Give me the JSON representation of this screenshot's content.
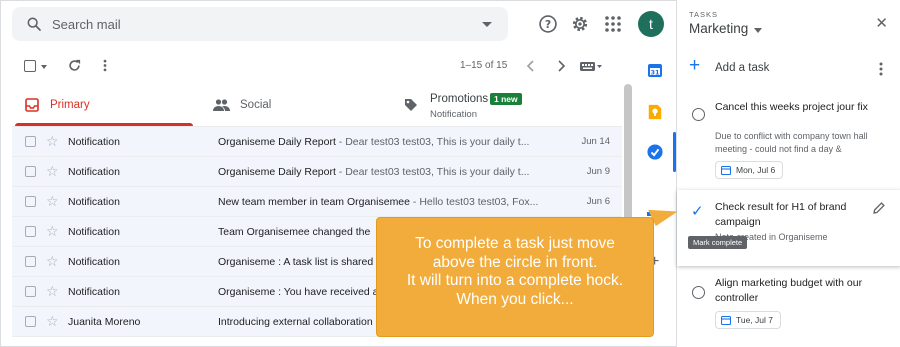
{
  "search": {
    "placeholder": "Search mail",
    "icon": "search-icon"
  },
  "topbar": {
    "help_icon": "help-icon",
    "settings_icon": "gear-icon",
    "apps_icon": "apps-grid-icon",
    "avatar_letter": "t",
    "avatar_color": "#1e6f5c"
  },
  "toolbar": {
    "pager": "1–15 of 15"
  },
  "tabs": [
    {
      "label": "Primary",
      "icon": "inbox-icon",
      "active": true
    },
    {
      "label": "Social",
      "icon": "people-icon"
    },
    {
      "label": "Promotions",
      "icon": "tag-icon",
      "sublabel": "Notification",
      "badge": "1 new"
    }
  ],
  "emails": [
    {
      "sender": "Notification",
      "subject": "Organiseme Daily Report",
      "snippet": " - Dear test03 test03, This is your daily t...",
      "date": "Jun 14"
    },
    {
      "sender": "Notification",
      "subject": "Organiseme Daily Report",
      "snippet": " - Dear test03 test03, This is your daily t...",
      "date": "Jun 9"
    },
    {
      "sender": "Notification",
      "subject": "New team member in team Organisemee",
      "snippet": " - Hello test03 test03, Fox...",
      "date": "Jun 6"
    },
    {
      "sender": "Notification",
      "subject": "Team Organisemee changed the",
      "snippet": "",
      "date": ""
    },
    {
      "sender": "Notification",
      "subject": "Organiseme : A task list is shared",
      "snippet": "",
      "date": ""
    },
    {
      "sender": "Notification",
      "subject": "Organiseme : You have received a",
      "snippet": "",
      "date": ""
    },
    {
      "sender": "Juanita Moreno",
      "subject": "Introducing external collaboration",
      "snippet": "",
      "date": ""
    }
  ],
  "tasks_panel": {
    "header_small": "TASKS",
    "list_name": "Marketing",
    "add_label": "Add a task",
    "tasks": [
      {
        "title": "Cancel this weeks project jour fix",
        "note": "Due to conflict with company town hall meeting - could not find a day &",
        "due": "Mon, Jul 6"
      },
      {
        "title": "Check result for H1 of brand campaign",
        "note": "Note created in Organiseme",
        "tooltip": "Mark complete"
      },
      {
        "title": "Align marketing budget with our controller",
        "due": "Tue, Jul 7"
      }
    ]
  },
  "callout": {
    "lines": [
      "To complete a task just move",
      "above the circle in front.",
      "It will turn into a complete hock.",
      "When you click..."
    ],
    "color": "#f2ac3b"
  },
  "colors": {
    "primary_red": "#d93025",
    "google_blue": "#1a73e8",
    "badge_green": "#188038"
  }
}
